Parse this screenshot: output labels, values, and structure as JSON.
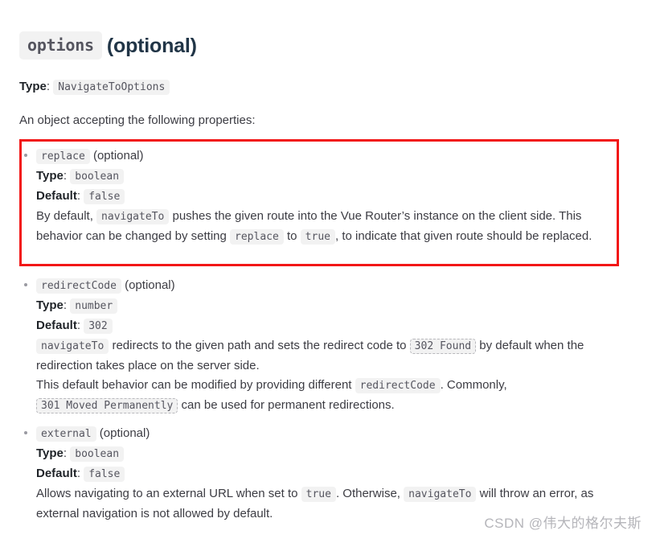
{
  "heading": {
    "code": "options",
    "suffix": "(optional)"
  },
  "type_line": {
    "label": "Type",
    "separator": ":",
    "value": "NavigateToOptions"
  },
  "intro": "An object accepting the following properties:",
  "annotation": {
    "color": "#f21616",
    "target": "replace"
  },
  "properties": [
    {
      "name": "replace",
      "optional": "(optional)",
      "type_label": "Type",
      "type_value": "boolean",
      "default_label": "Default",
      "default_value": "false",
      "paragraphs": [
        {
          "parts": [
            {
              "kind": "text",
              "text": "By default, "
            },
            {
              "kind": "code",
              "text": "navigateTo"
            },
            {
              "kind": "text",
              "text": " pushes the given route into the Vue Router’s instance on the client side. This behavior can be changed by setting "
            },
            {
              "kind": "code",
              "text": "replace"
            },
            {
              "kind": "text",
              "text": " to "
            },
            {
              "kind": "code",
              "text": "true"
            },
            {
              "kind": "text",
              "text": ", to indicate that given route should be replaced."
            }
          ]
        }
      ]
    },
    {
      "name": "redirectCode",
      "optional": "(optional)",
      "type_label": "Type",
      "type_value": "number",
      "default_label": "Default",
      "default_value": "302",
      "paragraphs": [
        {
          "parts": [
            {
              "kind": "code",
              "text": "navigateTo"
            },
            {
              "kind": "text",
              "text": " redirects to the given path and sets the redirect code to "
            },
            {
              "kind": "codelink",
              "text": "302 Found"
            },
            {
              "kind": "text",
              "text": " by default when the redirection takes place on the server side."
            }
          ]
        },
        {
          "parts": [
            {
              "kind": "text",
              "text": "This default behavior can be modified by providing different "
            },
            {
              "kind": "code",
              "text": "redirectCode"
            },
            {
              "kind": "text",
              "text": ". Commonly, "
            },
            {
              "kind": "codelink",
              "text": "301 Moved Permanently"
            },
            {
              "kind": "text",
              "text": " can be used for permanent redirections."
            }
          ]
        }
      ]
    },
    {
      "name": "external",
      "optional": "(optional)",
      "type_label": "Type",
      "type_value": "boolean",
      "default_label": "Default",
      "default_value": "false",
      "paragraphs": [
        {
          "parts": [
            {
              "kind": "text",
              "text": "Allows navigating to an external URL when set to "
            },
            {
              "kind": "code",
              "text": "true"
            },
            {
              "kind": "text",
              "text": ". Otherwise, "
            },
            {
              "kind": "code",
              "text": "navigateTo"
            },
            {
              "kind": "text",
              "text": " will throw an error, as external navigation is not allowed by default."
            }
          ]
        }
      ]
    }
  ],
  "watermark": "CSDN @伟大的格尔夫斯"
}
